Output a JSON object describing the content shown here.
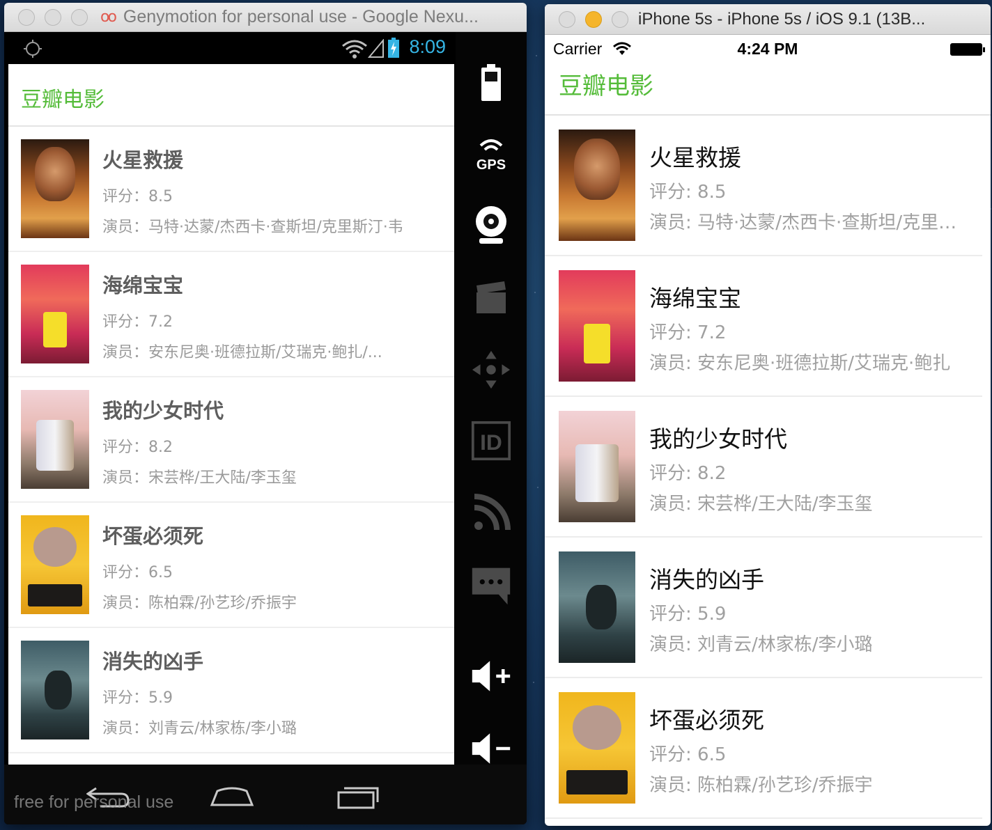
{
  "android_window": {
    "title": "Genymotion for personal use - Google Nexu...",
    "status_time": "8:09",
    "header_title": "豆瓣电影",
    "watermark": "free for personal use",
    "side_controls": [
      "battery-icon",
      "gps-icon",
      "webcam-icon",
      "video-capture-icon",
      "dpad-icon",
      "device-id-icon",
      "network-icon",
      "sms-icon",
      "volume-up-icon",
      "volume-down-icon"
    ],
    "movies": [
      {
        "title": "火星救援",
        "rating": "评分：8.5",
        "cast": "演员：马特·达蒙/杰西卡·查斯坦/克里斯汀·韦"
      },
      {
        "title": "海绵宝宝",
        "rating": "评分：7.2",
        "cast": "演员：安东尼奥·班德拉斯/艾瑞克·鲍扎/..."
      },
      {
        "title": "我的少女时代",
        "rating": "评分：8.2",
        "cast": "演员：宋芸桦/王大陆/李玉玺"
      },
      {
        "title": "坏蛋必须死",
        "rating": "评分：6.5",
        "cast": "演员：陈柏霖/孙艺珍/乔振宇"
      },
      {
        "title": "消失的凶手",
        "rating": "评分：5.9",
        "cast": "演员：刘青云/林家栋/李小璐"
      }
    ]
  },
  "ios_window": {
    "title": "iPhone 5s - iPhone 5s / iOS 9.1 (13B...",
    "carrier": "Carrier",
    "status_time": "4:24 PM",
    "header_title": "豆瓣电影",
    "movies": [
      {
        "title": "火星救援",
        "rating": "评分:  8.5",
        "cast": "演员:  马特·达蒙/杰西卡·查斯坦/克里斯汀·韦格"
      },
      {
        "title": "海绵宝宝",
        "rating": "评分:  7.2",
        "cast": "演员:  安东尼奥·班德拉斯/艾瑞克·鲍扎"
      },
      {
        "title": "我的少女时代",
        "rating": "评分:  8.2",
        "cast": "演员:  宋芸桦/王大陆/李玉玺"
      },
      {
        "title": "消失的凶手",
        "rating": "评分:  5.9",
        "cast": "演员:  刘青云/林家栋/李小璐"
      },
      {
        "title": "坏蛋必须死",
        "rating": "评分:  6.5",
        "cast": "演员:  陈柏霖/孙艺珍/乔振宇"
      }
    ]
  }
}
